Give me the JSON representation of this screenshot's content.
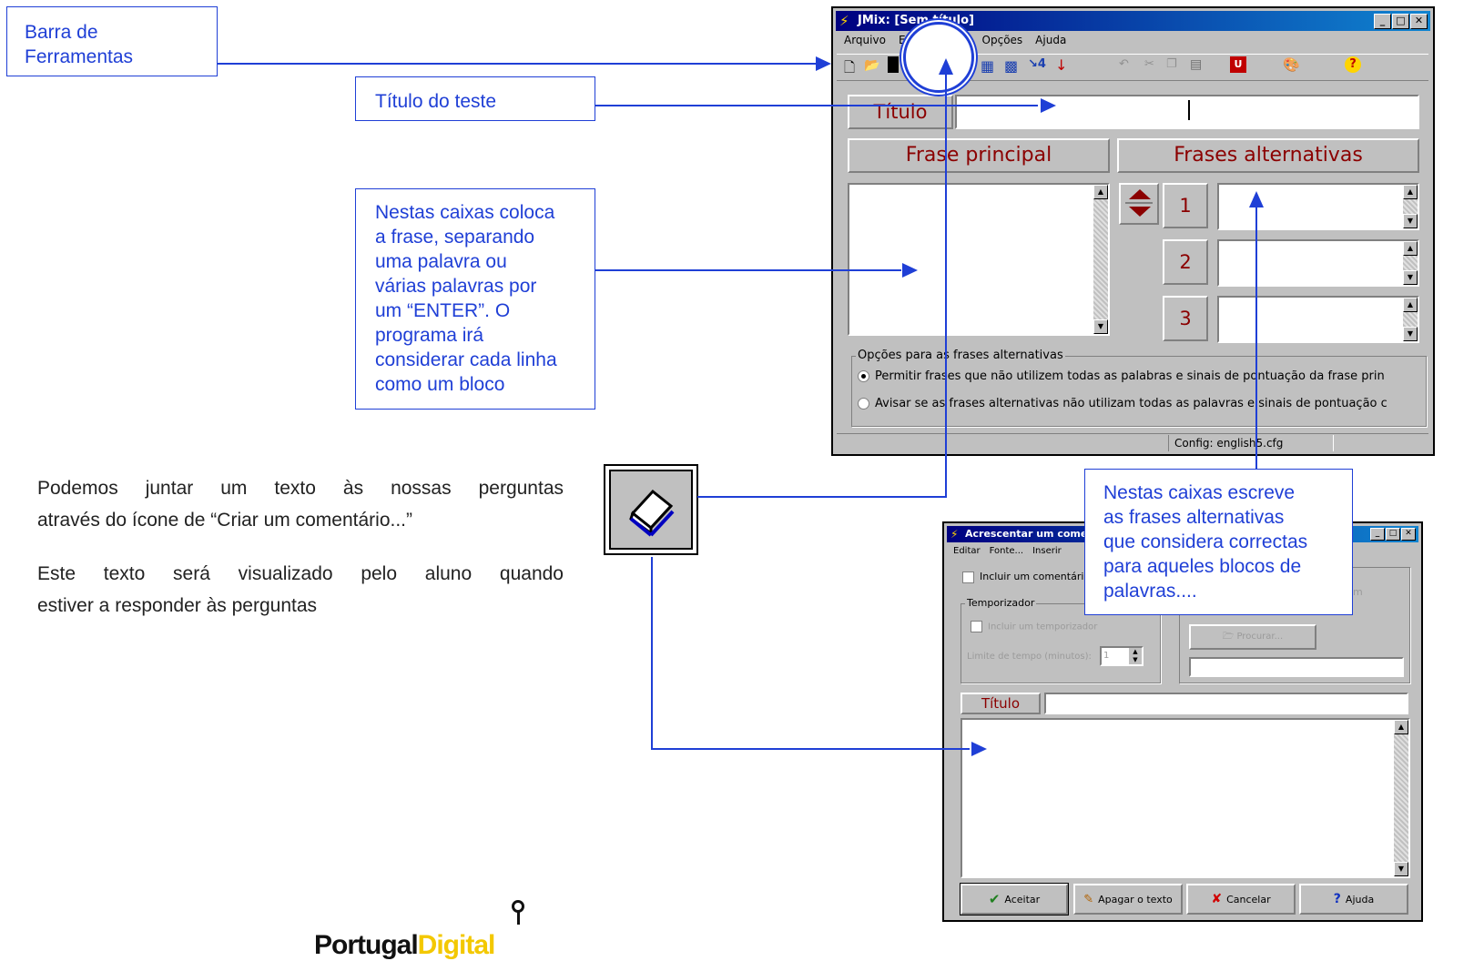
{
  "callouts": {
    "toolbar": [
      "Barra de",
      "Ferramentas"
    ],
    "title_test": "Título do teste",
    "main_boxes": [
      "Nestas caixas coloca",
      "a frase, separando",
      "uma palavra ou",
      "várias palavras por",
      "um “ENTER”. O",
      "programa irá",
      "considerar cada linha",
      "como um bloco"
    ],
    "alt_boxes": [
      "Nestas caixas escreve",
      "as frases alternativas",
      "que considera correctas",
      "para aqueles blocos de",
      "palavras...."
    ]
  },
  "body_text": {
    "p1_line1": "Podemos juntar um texto às nossas perguntas",
    "p1_line2": "através do ícone de “Criar um comentário...”",
    "p2_line1": "Este texto será visualizado pelo aluno quando",
    "p2_line2": "estiver a responder às perguntas"
  },
  "logo": {
    "text_dark": "Portugal",
    "text_color": "Digital"
  },
  "jmix": {
    "title": "JMix: [Sem título]",
    "menu": [
      "Arquivo",
      "E",
      "Opções",
      "Ajuda"
    ],
    "title_label": "Título",
    "main_header": "Frase principal",
    "alt_header": "Frases alternativas",
    "alt_numbers": [
      "1",
      "2",
      "3"
    ],
    "options_legend": "Opções para as frases alternativas",
    "option1": "Permitir frases que não utilizem todas as palabras e sinais de pontuação da frase prin",
    "option2": "Avisar se as frases alternativas não utilizam todas as palavras e sinais de pontuação c",
    "status": "Config: english5.cfg"
  },
  "dialog": {
    "title": "Acrescentar um comentá",
    "menu": [
      "Editar",
      "Fonte...",
      "Inserir"
    ],
    "include_comment": "Incluir um comentário",
    "timer_legend": "Temporizador",
    "include_timer": "Incluir um temporizador",
    "time_limit_label": "Limite de tempo (minutos):",
    "time_limit_value": "1",
    "browse_button": "Procurar...",
    "hidden_right": "m",
    "title_label": "Título",
    "buttons": {
      "accept": "Aceitar",
      "clear": "Apagar o texto",
      "cancel": "Cancelar",
      "help": "Ajuda"
    }
  },
  "colors": {
    "callout": "#1f3fd6",
    "titlebar": "#000080",
    "dark_red": "#8b0000",
    "window_grey": "#c0c0c0"
  }
}
